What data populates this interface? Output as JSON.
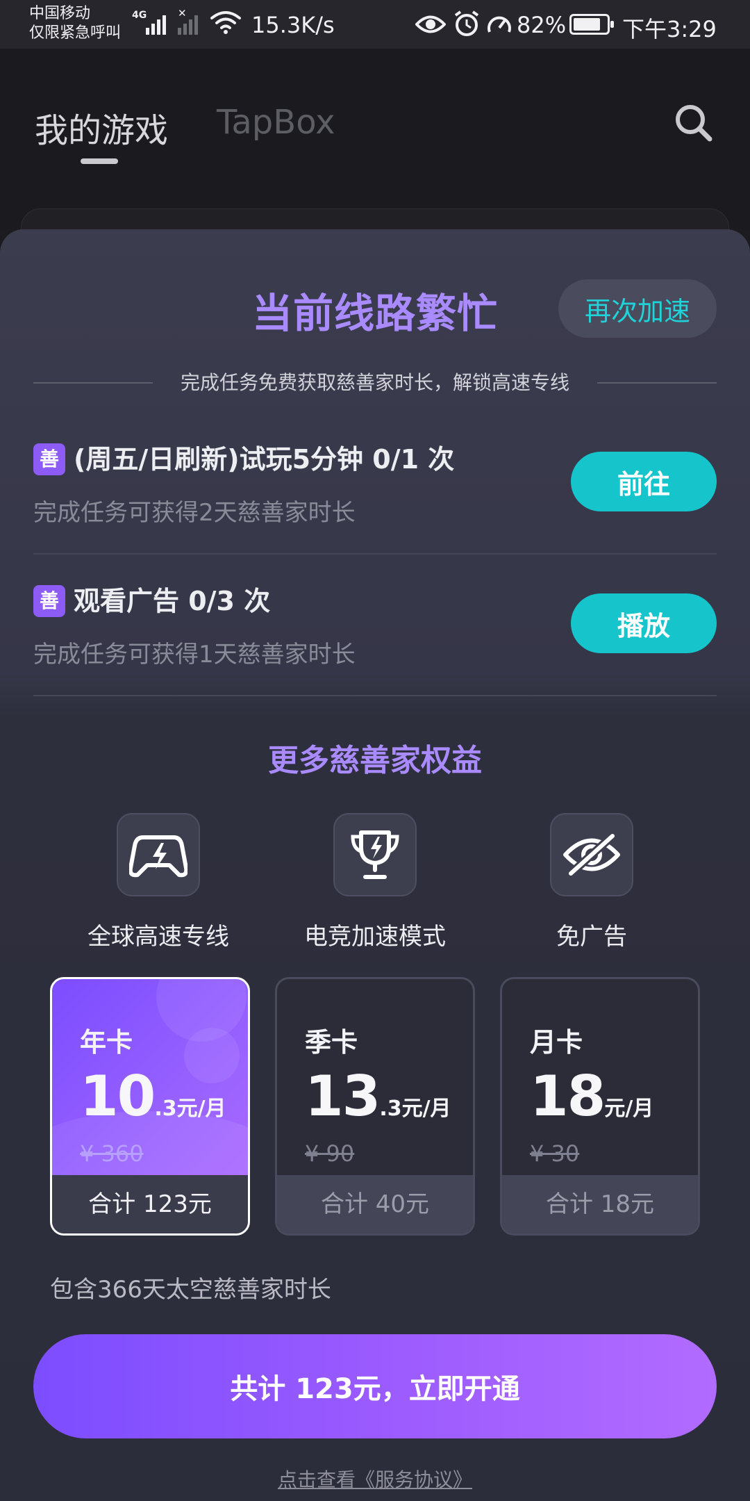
{
  "status_bar": {
    "carrier_line1": "中国移动",
    "carrier_line2": "仅限紧急呼叫",
    "network_type": "4G",
    "net_speed": "15.3K/s",
    "battery": "82%",
    "battery_level": 0.82,
    "time": "下午3:29"
  },
  "header": {
    "tabs": [
      {
        "label": "我的游戏",
        "active": true
      },
      {
        "label": "TapBox",
        "active": false
      }
    ]
  },
  "sheet": {
    "title": "当前线路繁忙",
    "reaccelerate_label": "再次加速",
    "divider_text": "完成任务免费获取慈善家时长，解锁高速专线",
    "tasks": [
      {
        "badge": "善",
        "title": "(周五/日刷新)试玩5分钟 0/1 次",
        "subtitle": "完成任务可获得2天慈善家时长",
        "button": "前往"
      },
      {
        "badge": "善",
        "title": "观看广告 0/3 次",
        "subtitle": "完成任务可获得1天慈善家时长",
        "button": "播放"
      }
    ],
    "benefits_title": "更多慈善家权益",
    "benefits": [
      {
        "icon": "gamepad-lightning-icon",
        "label": "全球高速专线"
      },
      {
        "icon": "trophy-icon",
        "label": "电竞加速模式"
      },
      {
        "icon": "eye-off-icon",
        "label": "免广告"
      }
    ],
    "plans": [
      {
        "name": "年卡",
        "price_int": "10",
        "price_rest": ".3元/月",
        "original": "¥ 360",
        "total": "合计 123元",
        "selected": true
      },
      {
        "name": "季卡",
        "price_int": "13",
        "price_rest": ".3元/月",
        "original": "¥ 90",
        "total": "合计 40元",
        "selected": false
      },
      {
        "name": "月卡",
        "price_int": "18",
        "price_rest": "元/月",
        "original": "¥ 30",
        "total": "合计 18元",
        "selected": false
      }
    ],
    "plan_note": "包含366天太空慈善家时长",
    "cta_label": "共计 123元，立即开通",
    "agreement_link": "点击查看《服务协议》"
  },
  "colors": {
    "accent_purple": "#a98bff",
    "accent_cyan": "#16c4cb",
    "cta_gradient_start": "#7c4dff",
    "cta_gradient_end": "#b16bff"
  }
}
